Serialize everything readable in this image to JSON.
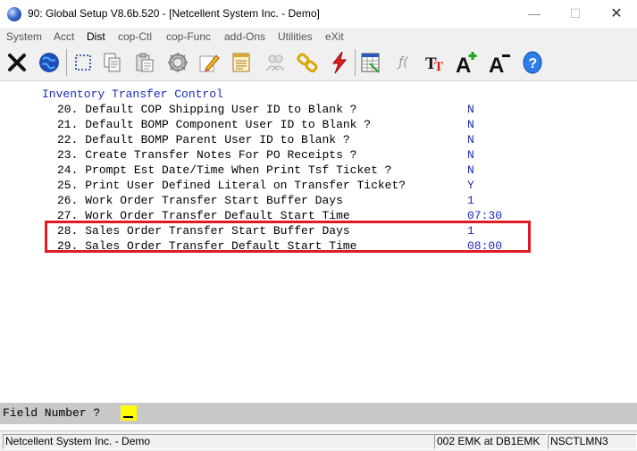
{
  "window": {
    "title": "90: Global Setup V8.6b.520 - [Netcellent System Inc. - Demo]",
    "minimize": "—",
    "maximize": "☐",
    "close": "✕"
  },
  "menu": [
    "System",
    "Acct",
    "Dist",
    "cop-Ctl",
    "cop-Func",
    "add-Ons",
    "Utilities",
    "eXit"
  ],
  "toolbar": {
    "icons": [
      "exit-icon",
      "globe-icon",
      "select-icon",
      "copy-icon",
      "paste-icon",
      "settings-icon",
      "edit-icon",
      "notes-icon",
      "users-icon",
      "link-icon",
      "lightning-icon",
      "spreadsheet-icon",
      "function-icon",
      "font-icon",
      "font-increase-icon",
      "font-decrease-icon",
      "help-icon"
    ]
  },
  "screen": {
    "heading": "Inventory Transfer Control",
    "rows": [
      {
        "num": "20.",
        "label": "Default COP Shipping User ID to Blank ?",
        "value": "N"
      },
      {
        "num": "21.",
        "label": "Default BOMP Component User ID to Blank ?",
        "value": "N"
      },
      {
        "num": "22.",
        "label": "Default BOMP Parent User ID to Blank ?",
        "value": "N"
      },
      {
        "num": "23.",
        "label": "Create Transfer Notes For PO Receipts ?",
        "value": "N"
      },
      {
        "num": "24.",
        "label": "Prompt Est Date/Time When Print Tsf Ticket ?",
        "value": "N"
      },
      {
        "num": "25.",
        "label": "Print User Defined Literal on Transfer Ticket?",
        "value": "Y"
      },
      {
        "num": "26.",
        "label": "Work Order Transfer Start Buffer Days",
        "value": "1"
      },
      {
        "num": "27.",
        "label": "Work Order Transfer Default Start Time",
        "value": "07:30"
      },
      {
        "num": "28.",
        "label": "Sales Order Transfer Start Buffer Days",
        "value": "1"
      },
      {
        "num": "29.",
        "label": "Sales Order Transfer Default Start Time",
        "value": "08:00"
      }
    ],
    "highlight_color": "#e01b24"
  },
  "prompt": {
    "label": "Field Number ?",
    "value": ""
  },
  "status": {
    "company": "Netcellent System Inc. - Demo",
    "session": "002 EMK at DB1EMK",
    "server": "NSCTLMN3"
  }
}
